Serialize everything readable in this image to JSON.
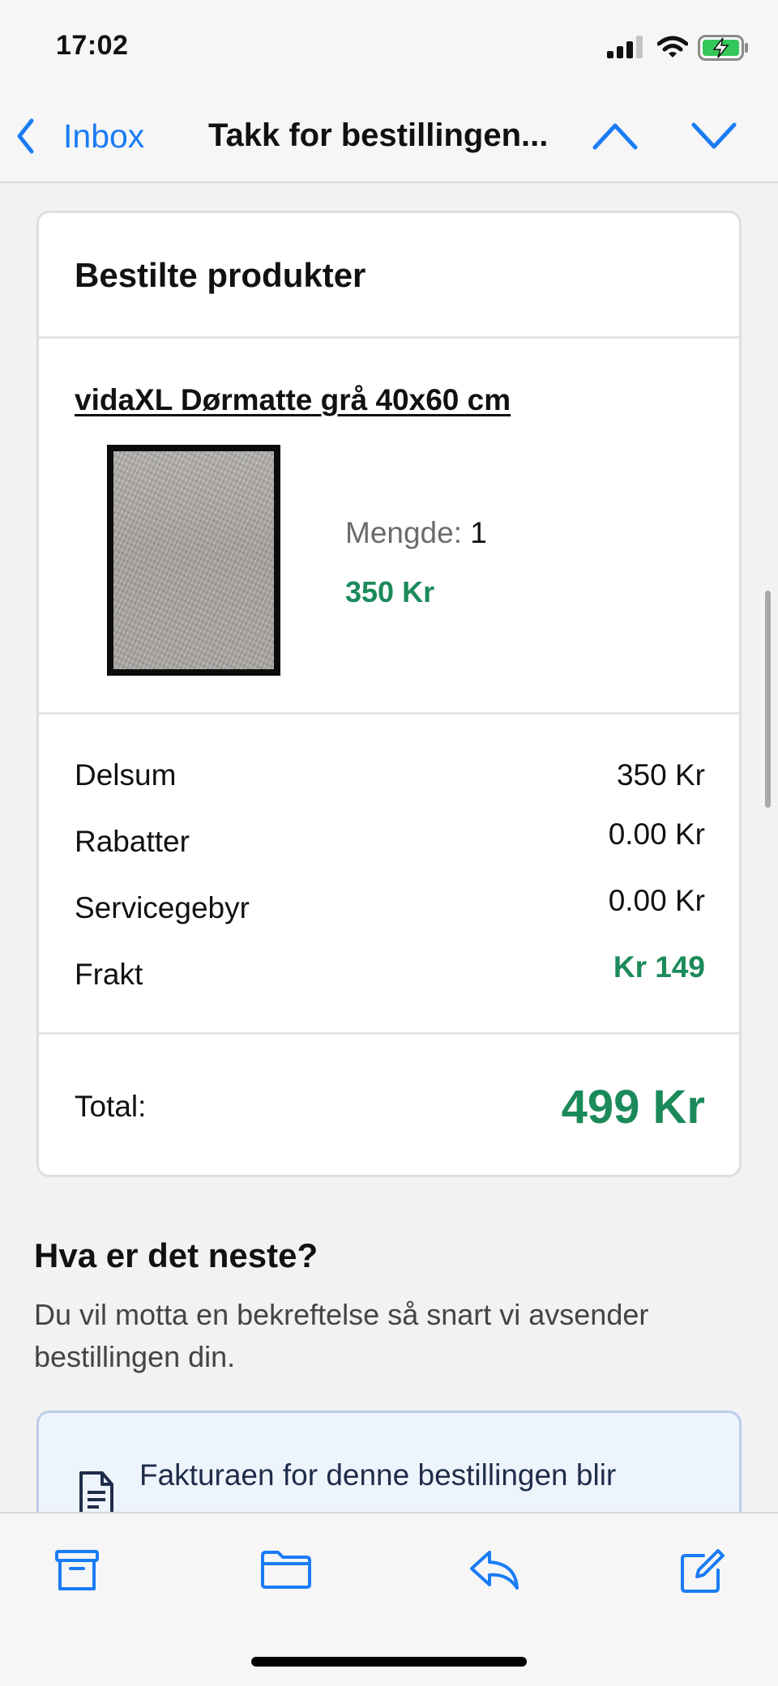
{
  "status_bar": {
    "time": "17:02",
    "icons": [
      "cellular-signal-icon",
      "wifi-icon",
      "battery-charging-icon"
    ]
  },
  "nav": {
    "back_label": "Inbox",
    "title": "Takk for bestillingen...",
    "icons": [
      "back-chevron-icon",
      "previous-message-icon",
      "next-message-icon"
    ]
  },
  "order_card": {
    "heading": "Bestilte produkter",
    "product": {
      "name": "vidaXL Dørmatte grå 40x60 cm",
      "quantity_label": "Mengde:",
      "quantity": "1",
      "price": "350 Kr"
    },
    "summary": {
      "rows": [
        {
          "label": "Delsum",
          "value": "350 Kr",
          "emphasis": false
        },
        {
          "label": "Rabatter",
          "value": "0.00 Kr",
          "emphasis": false
        },
        {
          "label": "Servicegebyr",
          "value": "0.00 Kr",
          "emphasis": false
        },
        {
          "label": "Frakt",
          "value": "Kr 149",
          "emphasis": true
        }
      ]
    },
    "total": {
      "label": "Total:",
      "value": "499 Kr"
    }
  },
  "next_section": {
    "heading": "Hva er det neste?",
    "body": "Du vil motta en bekreftelse så snart vi avsender bestillingen din."
  },
  "info_box": {
    "icon": "invoice-icon",
    "text": "Fakturaen for denne bestillingen blir"
  },
  "toolbar": {
    "icons": [
      "archive-icon",
      "folder-icon",
      "reply-icon",
      "compose-icon"
    ]
  },
  "colors": {
    "accent_blue": "#1a7cf5",
    "price_green": "#1b8a5a",
    "info_box_bg": "#eef4fc",
    "info_box_border": "#bccde8"
  }
}
